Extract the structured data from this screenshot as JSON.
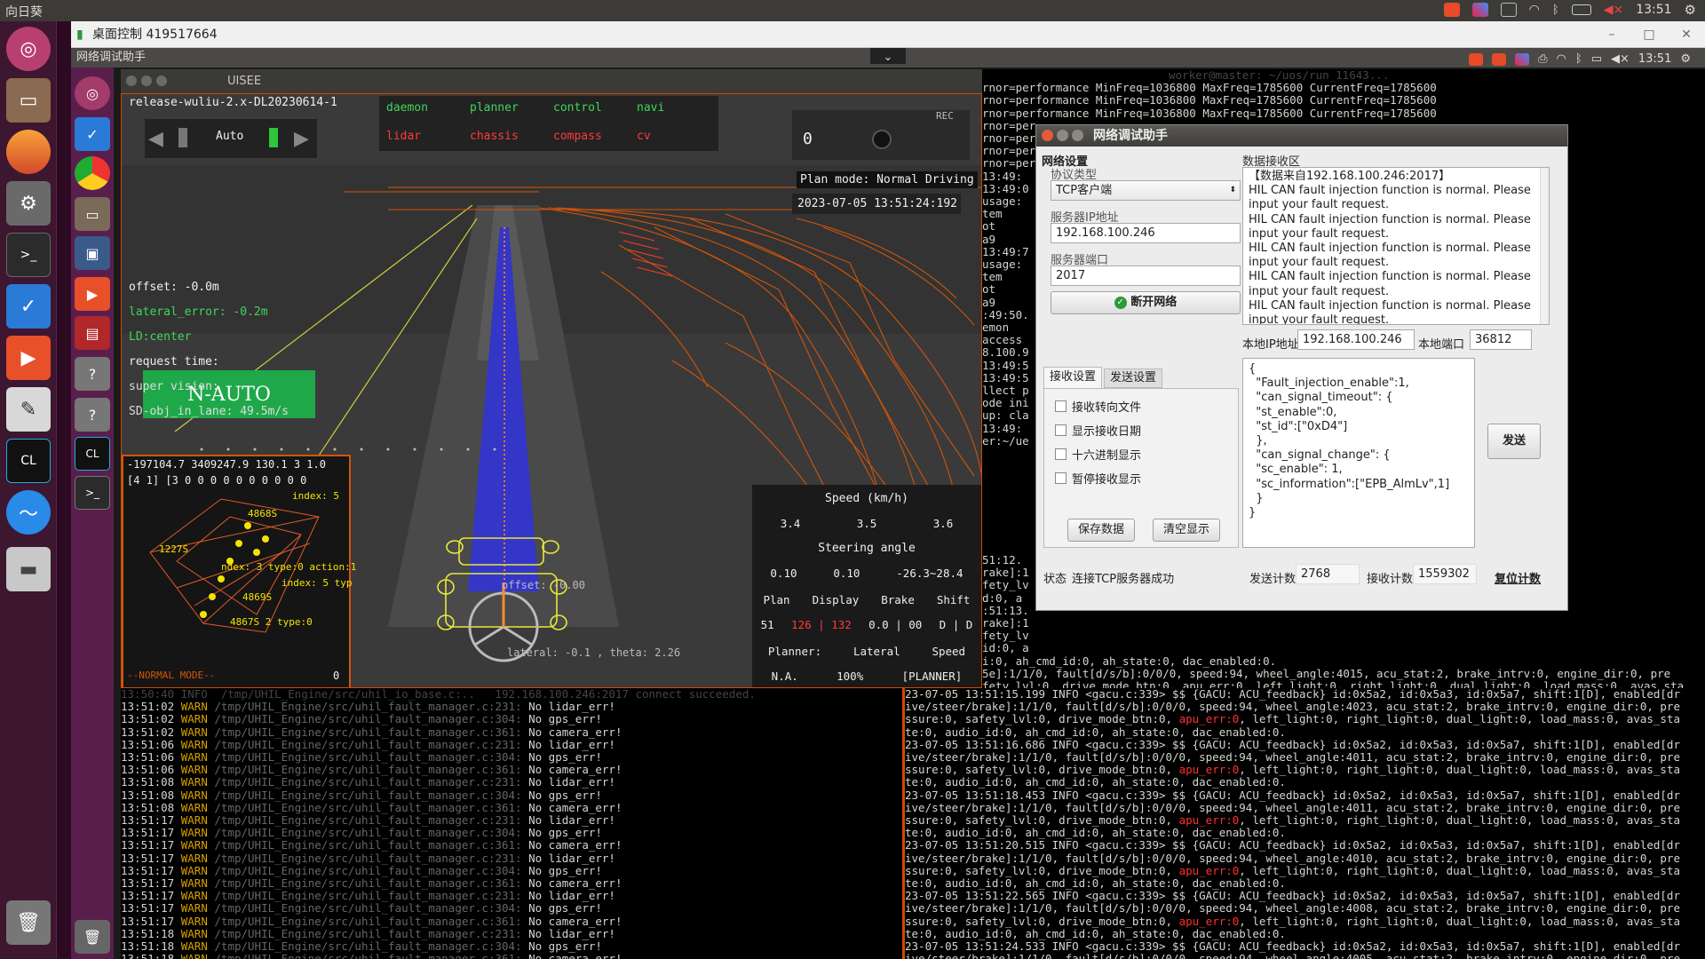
{
  "top_bar": {
    "title": "向日葵",
    "time": "13:51"
  },
  "remote_window": {
    "title": "桌面控制 419517664",
    "minimize": "–",
    "maximize": "□",
    "close": "✕"
  },
  "inner_bar": {
    "title": "网络调试助手",
    "time": "13:51"
  },
  "uisee": {
    "title": "UISEE",
    "release": "release-wuliu-2.x-DL20230614-1",
    "mode": "Auto",
    "modules_row1": [
      "daemon",
      "planner",
      "control",
      "navi"
    ],
    "modules_row2": [
      "lidar",
      "chassis",
      "compass",
      "cv"
    ],
    "rec": "REC",
    "counter": "0",
    "plan_mode": "Plan mode: Normal Driving",
    "datetime": "2023-07-05 13:51:24:192",
    "offset": "offset: -0.0m",
    "lateral_error": "lateral_error: -0.2m",
    "ld": "LD:center",
    "request_time": "request time:",
    "super_vision": "super vision:",
    "n_auto": "N-AUTO",
    "sd_obj": "SD-obj_in_lane: 49.5m/s",
    "coords": "-197104.7 3409247.9 130.1 3 1.0",
    "row2": "[4 1]  [3 0 0 0 0 0 0 0 0 0 0",
    "minimap_labels": [
      "index: 5",
      "4868S",
      "1227S",
      "ndex: 3 type:0 action:1",
      "index: 5 typ",
      "4869S",
      "4867S 2 type:0"
    ],
    "normal_mode": "--NORMAL MODE--",
    "minimap_zero": "0",
    "road_offset": "offset: -0.00",
    "road_lateral": "lateral: -0.1 , theta: 2.26",
    "speed_title": "Speed (km/h)",
    "speed_vals": [
      "3.4",
      "3.5",
      "3.6"
    ],
    "steer_title": "Steering angle",
    "steer_vals": [
      "0.10",
      "0.10",
      "-26.3~28.4"
    ],
    "status_headers": [
      "Plan",
      "Display",
      "Brake",
      "Shift"
    ],
    "status_vals": [
      "51",
      "126 | 132",
      "0.0 | 00",
      "D | D"
    ],
    "planner_headers": [
      "Planner:",
      "Lateral",
      "Speed"
    ],
    "planner_vals": [
      "N.A.",
      "100%",
      "[PLANNER]"
    ]
  },
  "net_assistant": {
    "title": "网络调试助手",
    "net_settings": "网络设置",
    "protocol_label": "协议类型",
    "protocol": "TCP客户端",
    "server_ip_label": "服务器IP地址",
    "server_ip": "192.168.100.246",
    "server_port_label": "服务器端口",
    "server_port": "2017",
    "disconnect": "断开网络",
    "recv_area_label": "数据接收区",
    "recv_lines": [
      "【数据来自192.168.100.246:2017】",
      "HIL CAN fault injection function is normal.  Please",
      "input your fault request.",
      "HIL CAN fault injection function is normal.  Please",
      "input your fault request.",
      "HIL CAN fault injection function is normal.  Please",
      "input your fault request.",
      "HIL CAN fault injection function is normal.  Please",
      "input your fault request.",
      "HIL CAN fault injection function is normal.  Please",
      "input your fault request."
    ],
    "local_ip_label": "本地IP地址",
    "local_ip": "192.168.100.246",
    "local_port_label": "本地端口",
    "local_port": "36812",
    "tab_recv": "接收设置",
    "tab_send": "发送设置",
    "options": [
      "接收转向文件",
      "显示接收日期",
      "十六进制显示",
      "暂停接收显示"
    ],
    "save_data": "保存数据",
    "clear_display": "清空显示",
    "send_lines": [
      "{",
      "  \"Fault_injection_enable\":1,",
      "  \"can_signal_timeout\": {",
      "  \"st_enable\":0,",
      "  \"st_id\":[\"0xD4\"]",
      "  },",
      "  \"can_signal_change\": {",
      "  \"sc_enable\": 1,",
      "  \"sc_information\":[\"EPB_AlmLv\",1]",
      "  }",
      "}"
    ],
    "send": "发送",
    "status_label": "状态",
    "status": "连接TCP服务器成功",
    "send_count_label": "发送计数",
    "send_count": "2768",
    "recv_count_label": "接收计数",
    "recv_count": "1559302",
    "reset_count": "复位计数"
  },
  "term_top": {
    "header": "worker@master: ~/uos/run_11643...",
    "lines": [
      "rnor=performance MinFreq=1036800 MaxFreq=1785600 CurrentFreq=1785600",
      "rnor=performance MinFreq=1036800 MaxFreq=1785600 CurrentFreq=1785600",
      "rnor=performance MinFreq=1036800 MaxFreq=1785600 CurrentFreq=1785600",
      "rnor=per",
      "rnor=per",
      "rnor=per",
      "rnor=per",
      "13:49:",
      "13:49:0",
      "usage:",
      "tem",
      "ot",
      "a9",
      "",
      "13:49:7",
      "usage:",
      "tem",
      "ot",
      "a9",
      "",
      ":49:50.",
      "emon",
      "access",
      "8.100.9",
      "13:49:5",
      "13:49:5",
      "llect p",
      "ode ini",
      "up: cla",
      "13:49:",
      "er:~/ue"
    ]
  },
  "term_left": {
    "header": "13:50:40 INFO  /tmp/UHIL_Engine/src/uhil_io_base.c:..   192.168.100.246:2017 connect succeeded.",
    "lines": [
      [
        "13:51:02",
        "WARN",
        "/tmp/UHIL_Engine/src/uhil_fault_manager.c:231:",
        "No lidar_err!"
      ],
      [
        "13:51:02",
        "WARN",
        "/tmp/UHIL_Engine/src/uhil_fault_manager.c:304:",
        "No gps_err!"
      ],
      [
        "13:51:02",
        "WARN",
        "/tmp/UHIL_Engine/src/uhil_fault_manager.c:361:",
        "No camera_err!"
      ],
      [
        "13:51:06",
        "WARN",
        "/tmp/UHIL_Engine/src/uhil_fault_manager.c:231:",
        "No lidar_err!"
      ],
      [
        "13:51:06",
        "WARN",
        "/tmp/UHIL_Engine/src/uhil_fault_manager.c:304:",
        "No gps_err!"
      ],
      [
        "13:51:06",
        "WARN",
        "/tmp/UHIL_Engine/src/uhil_fault_manager.c:361:",
        "No camera_err!"
      ],
      [
        "13:51:08",
        "WARN",
        "/tmp/UHIL_Engine/src/uhil_fault_manager.c:231:",
        "No lidar_err!"
      ],
      [
        "13:51:08",
        "WARN",
        "/tmp/UHIL_Engine/src/uhil_fault_manager.c:304:",
        "No gps_err!"
      ],
      [
        "13:51:08",
        "WARN",
        "/tmp/UHIL_Engine/src/uhil_fault_manager.c:361:",
        "No camera_err!"
      ],
      [
        "13:51:17",
        "WARN",
        "/tmp/UHIL_Engine/src/uhil_fault_manager.c:231:",
        "No lidar_err!"
      ],
      [
        "13:51:17",
        "WARN",
        "/tmp/UHIL_Engine/src/uhil_fault_manager.c:304:",
        "No gps_err!"
      ],
      [
        "13:51:17",
        "WARN",
        "/tmp/UHIL_Engine/src/uhil_fault_manager.c:361:",
        "No camera_err!"
      ],
      [
        "13:51:17",
        "WARN",
        "/tmp/UHIL_Engine/src/uhil_fault_manager.c:231:",
        "No lidar_err!"
      ],
      [
        "13:51:17",
        "WARN",
        "/tmp/UHIL_Engine/src/uhil_fault_manager.c:304:",
        "No gps_err!"
      ],
      [
        "13:51:17",
        "WARN",
        "/tmp/UHIL_Engine/src/uhil_fault_manager.c:361:",
        "No camera_err!"
      ],
      [
        "13:51:17",
        "WARN",
        "/tmp/UHIL_Engine/src/uhil_fault_manager.c:231:",
        "No lidar_err!"
      ],
      [
        "13:51:17",
        "WARN",
        "/tmp/UHIL_Engine/src/uhil_fault_manager.c:304:",
        "No gps_err!"
      ],
      [
        "13:51:17",
        "WARN",
        "/tmp/UHIL_Engine/src/uhil_fault_manager.c:361:",
        "No camera_err!"
      ],
      [
        "13:51:18",
        "WARN",
        "/tmp/UHIL_Engine/src/uhil_fault_manager.c:231:",
        "No lidar_err!"
      ],
      [
        "13:51:18",
        "WARN",
        "/tmp/UHIL_Engine/src/uhil_fault_manager.c:304:",
        "No gps_err!"
      ],
      [
        "13:51:18",
        "WARN",
        "/tmp/UHIL_Engine/src/uhil_fault_manager.c:361:",
        "No camera_err!"
      ]
    ]
  },
  "term_right": {
    "lines": [
      "23-07-05 13:51:15.199 INFO <gacu.c:339> $$ {GACU: ACU_feedback} id:0x5a2, id:0x5a3, id:0x5a7, shift:1[D], enabled[dr",
      "ive/steer/brake]:1/1/0, fault[d/s/b]:0/0/0, speed:94, wheel_angle:4023, acu_stat:2, brake_intrv:0, engine_dir:0, pre",
      "ssure:0, safety_lvl:0, drive_mode_btn:0, apu_err:0, left_light:0, right_light:0, dual_light:0, load_mass:0, avas_sta",
      "te:0, audio_id:0, ah_cmd_id:0, ah_state:0, dac_enabled:0.",
      "23-07-05 13:51:16.686 INFO <gacu.c:339> $$ {GACU: ACU_feedback} id:0x5a2, id:0x5a3, id:0x5a7, shift:1[D], enabled[dr",
      "ive/steer/brake]:1/1/0, fault[d/s/b]:0/0/0, speed:94, wheel_angle:4011, acu_stat:2, brake_intrv:0, engine_dir:0, pre",
      "ssure:0, safety_lvl:0, drive_mode_btn:0, apu_err:0, left_light:0, right_light:0, dual_light:0, load_mass:0, avas_sta",
      "te:0, audio_id:0, ah_cmd_id:0, ah_state:0, dac_enabled:0.",
      "23-07-05 13:51:18.453 INFO <gacu.c:339> $$ {GACU: ACU_feedback} id:0x5a2, id:0x5a3, id:0x5a7, shift:1[D], enabled[dr",
      "ive/steer/brake]:1/1/0, fault[d/s/b]:0/0/0, speed:94, wheel_angle:4011, acu_stat:2, brake_intrv:0, engine_dir:0, pre",
      "ssure:0, safety_lvl:0, drive_mode_btn:0, apu_err:0, left_light:0, right_light:0, dual_light:0, load_mass:0, avas_sta",
      "te:0, audio_id:0, ah_cmd_id:0, ah_state:0, dac_enabled:0.",
      "23-07-05 13:51:20.515 INFO <gacu.c:339> $$ {GACU: ACU_feedback} id:0x5a2, id:0x5a3, id:0x5a7, shift:1[D], enabled[dr",
      "ive/steer/brake]:1/1/0, fault[d/s/b]:0/0/0, speed:94, wheel_angle:4010, acu_stat:2, brake_intrv:0, engine_dir:0, pre",
      "ssure:0, safety_lvl:0, drive_mode_btn:0, apu_err:0, left_light:0, right_light:0, dual_light:0, load_mass:0, avas_sta",
      "te:0, audio_id:0, ah_cmd_id:0, ah_state:0, dac_enabled:0.",
      "23-07-05 13:51:22.565 INFO <gacu.c:339> $$ {GACU: ACU_feedback} id:0x5a2, id:0x5a3, id:0x5a7, shift:1[D], enabled[dr",
      "ive/steer/brake]:1/1/0, fault[d/s/b]:0/0/0, speed:94, wheel_angle:4008, acu_stat:2, brake_intrv:0, engine_dir:0, pre",
      "ssure:0, safety_lvl:0, drive_mode_btn:0, apu_err:0, left_light:0, right_light:0, dual_light:0, load_mass:0, avas_sta",
      "te:0, audio_id:0, ah_cmd_id:0, ah_state:0, dac_enabled:0.",
      "23-07-05 13:51:24.533 INFO <gacu.c:339> $$ {GACU: ACU_feedback} id:0x5a2, id:0x5a3, id:0x5a7, shift:1[D], enabled[dr",
      "ive/steer/brake]:1/1/0, fault[d/s/b]:0/0/0, speed:94, wheel_angle:4005, acu_stat:2, brake_intrv:0, engine_dir:0, pre",
      "ssure:0, safety_lvl:0, drive_mode_btn:0, apu_err:0, left_light:0, right_light:0, dual_light:0, load_mass:0, avas_sta",
      "te:0, audio_id:0, ah_cmd_id:0, ah_state:0, dac_enabled:0."
    ]
  },
  "term_right_top": {
    "lines": [
      "51:12.",
      "rake]:1",
      "fety_lv",
      "d:0, a",
      ":51:13.",
      "rake]:1",
      "fety_lv",
      "id:0, a",
      "i:0, ah_cmd_id:0, ah_state:0, dac_enabled:0.",
      "5e]:1/1/0, fault[d/s/b]:0/0/0, speed:94, wheel_angle:4015, acu_stat:2, brake_intrv:0, engine_dir:0, pre",
      "fety_lvl:0, drive_mode_btn:0, apu_err:0, left_light:0, right_light:0, dual_light:0, load_mass:0, avas_sta"
    ]
  },
  "colors": {
    "accent_orange": "#d24a00",
    "warn": "#d5a000",
    "error": "#ff3030",
    "auto_green": "#1fa84a",
    "module_green": "#3fd65a",
    "module_red": "#ff3b3b"
  },
  "icons": {
    "launcher": [
      "ubuntu-icon",
      "files-icon",
      "firefox-icon",
      "settings-icon",
      "terminal-icon",
      "sunlogin-icon",
      "sunlogin-remote-icon",
      "text-editor-icon",
      "clion-icon",
      "network-icon",
      "drive-icon",
      "trash-icon"
    ],
    "inner_launcher": [
      "ubuntu-icon",
      "sunlogin-icon",
      "chrome-icon",
      "files-icon",
      "monitor-icon",
      "sunlogin-remote-icon",
      "app-icon",
      "unknown-icon",
      "unknown-icon",
      "clion-icon",
      "terminal-icon",
      "trash-icon"
    ]
  }
}
